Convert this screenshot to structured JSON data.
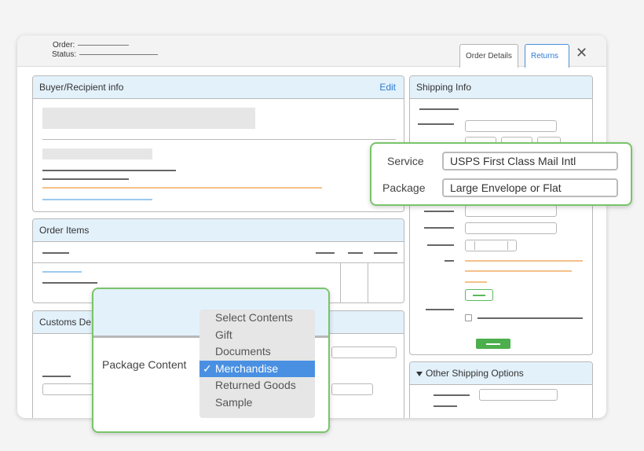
{
  "header": {
    "order_label": "Order:",
    "status_label": "Status:",
    "tabs": [
      {
        "label": "Order Details",
        "active": true
      },
      {
        "label": "Returns",
        "active": false
      }
    ],
    "close_icon": "close-icon"
  },
  "buyer_panel": {
    "title": "Buyer/Recipient info",
    "edit_label": "Edit"
  },
  "order_items_panel": {
    "title": "Order Items"
  },
  "customs_panel": {
    "title": "Customs De"
  },
  "shipping_panel": {
    "title": "Shipping Info"
  },
  "other_shipping": {
    "title": "Other Shipping Options",
    "icon": "caret-down-icon"
  },
  "service_callout": {
    "service_label": "Service",
    "service_value": "USPS First Class Mail Intl",
    "package_label": "Package",
    "package_value": "Large Envelope or Flat"
  },
  "package_content": {
    "label": "Package Content",
    "selected": "Merchandise",
    "options": [
      "Select Contents",
      "Gift",
      "Documents",
      "Merchandise",
      "Returned Goods",
      "Sample"
    ]
  },
  "colors": {
    "accent": "#4a90e2",
    "callout_border": "#79c46a",
    "panel_header": "#e3f1fb",
    "green_button": "#4cae4c"
  }
}
